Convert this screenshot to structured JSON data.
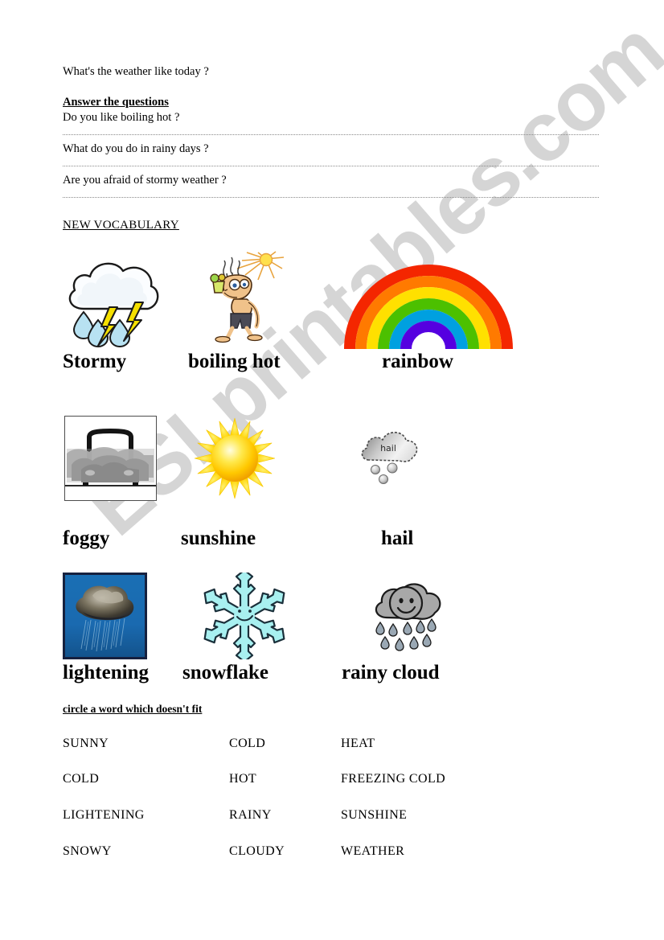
{
  "worksheet": {
    "intro_question": "What's the weather like today ?",
    "answer_section": {
      "heading": "Answer the questions",
      "questions": [
        "Do you like boiling hot ?",
        "What do you do in rainy days ?",
        "Are you afraid of stormy weather ?"
      ]
    },
    "vocabulary": {
      "heading": "NEW VOCABULARY",
      "items": [
        {
          "label": "Stormy",
          "icon": "storm-cloud-rain-lightning-icon"
        },
        {
          "label": "boiling hot",
          "icon": "man-sweating-in-sun-icon"
        },
        {
          "label": "rainbow",
          "icon": "rainbow-icon"
        },
        {
          "label": "foggy",
          "icon": "car-in-fog-icon"
        },
        {
          "label": "sunshine",
          "icon": "sun-icon"
        },
        {
          "label": "hail",
          "icon": "hail-cloud-icon"
        },
        {
          "label": "lightening",
          "icon": "lightning-storm-photo-icon"
        },
        {
          "label": "snowflake",
          "icon": "snowflake-smiley-icon"
        },
        {
          "label": "rainy cloud",
          "icon": "rainy-cloud-smiley-icon"
        }
      ]
    },
    "odd_one_out": {
      "heading": "circle  a word which doesn't fit",
      "rows": [
        [
          "SUNNY",
          "COLD",
          "HEAT"
        ],
        [
          "COLD",
          "HOT",
          "FREEZING COLD"
        ],
        [
          "LIGHTENING",
          "RAINY",
          "SUNSHINE"
        ],
        [
          "SNOWY",
          "CLOUDY",
          "WEATHER"
        ]
      ]
    },
    "hail_cloud_text": "hail",
    "watermark": "ESLprintables.com",
    "colors": {
      "watermark": "#d3d3d3",
      "rule": "#8a8a8a",
      "rainbow_red": "#f42600",
      "rainbow_orange": "#ff7a00",
      "rainbow_yellow": "#ffe000",
      "rainbow_green": "#4cc000",
      "rainbow_blue": "#5500e0",
      "sun_yellow": "#ffd400",
      "snowflake_cyan": "#a8f0f0",
      "cloud_gray": "#a8a8a8",
      "fog_gray": "#9a9a9a",
      "storm_photo_blue": "#1565a8",
      "raindrop_blue": "#9fd8ee",
      "lightning_yellow": "#f5e000"
    }
  }
}
